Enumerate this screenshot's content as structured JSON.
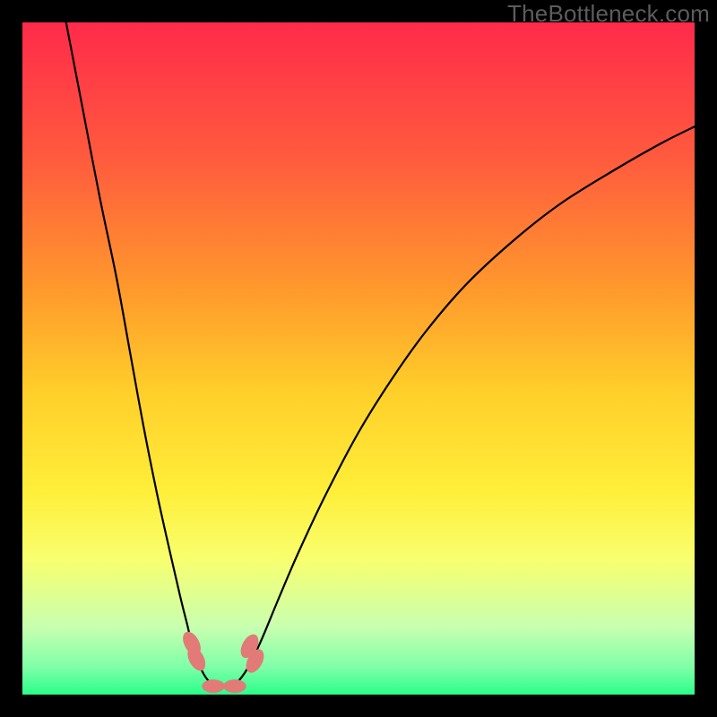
{
  "watermark_text": "TheBottleneck.com",
  "chart_data": {
    "type": "line",
    "title": "",
    "xlabel": "",
    "ylabel": "",
    "xlim": [
      0,
      100
    ],
    "ylim": [
      0,
      100
    ],
    "grid": false,
    "legend": false,
    "gradient_stops": [
      {
        "offset": 0.0,
        "color": "#ff2a4a"
      },
      {
        "offset": 0.2,
        "color": "#ff5a3e"
      },
      {
        "offset": 0.4,
        "color": "#ff9a2c"
      },
      {
        "offset": 0.55,
        "color": "#ffcf2a"
      },
      {
        "offset": 0.7,
        "color": "#ffef3a"
      },
      {
        "offset": 0.8,
        "color": "#f8ff70"
      },
      {
        "offset": 0.9,
        "color": "#c8ffb0"
      },
      {
        "offset": 0.96,
        "color": "#7effa8"
      },
      {
        "offset": 1.0,
        "color": "#2aff8a"
      }
    ],
    "series": [
      {
        "name": "left-branch",
        "stroke": "#000000",
        "stroke_width": 2.2,
        "points": [
          {
            "x": 6.5,
            "y": 100.0
          },
          {
            "x": 9.0,
            "y": 87.0
          },
          {
            "x": 11.5,
            "y": 74.0
          },
          {
            "x": 14.0,
            "y": 62.0
          },
          {
            "x": 16.0,
            "y": 51.0
          },
          {
            "x": 18.0,
            "y": 40.0
          },
          {
            "x": 20.0,
            "y": 30.0
          },
          {
            "x": 22.0,
            "y": 21.0
          },
          {
            "x": 23.5,
            "y": 14.5
          },
          {
            "x": 24.5,
            "y": 10.5
          },
          {
            "x": 25.5,
            "y": 6.5
          },
          {
            "x": 27.0,
            "y": 3.0
          },
          {
            "x": 28.5,
            "y": 1.4
          },
          {
            "x": 30.0,
            "y": 1.1
          }
        ]
      },
      {
        "name": "right-branch",
        "stroke": "#000000",
        "stroke_width": 2.2,
        "points": [
          {
            "x": 30.0,
            "y": 1.1
          },
          {
            "x": 31.5,
            "y": 1.4
          },
          {
            "x": 33.5,
            "y": 3.9
          },
          {
            "x": 35.5,
            "y": 8.0
          },
          {
            "x": 38.0,
            "y": 14.0
          },
          {
            "x": 41.0,
            "y": 21.0
          },
          {
            "x": 45.0,
            "y": 29.5
          },
          {
            "x": 50.0,
            "y": 39.0
          },
          {
            "x": 55.0,
            "y": 47.0
          },
          {
            "x": 60.0,
            "y": 54.0
          },
          {
            "x": 66.0,
            "y": 61.0
          },
          {
            "x": 73.0,
            "y": 67.5
          },
          {
            "x": 80.0,
            "y": 73.0
          },
          {
            "x": 88.0,
            "y": 78.0
          },
          {
            "x": 95.0,
            "y": 82.0
          },
          {
            "x": 100.0,
            "y": 84.5
          }
        ]
      }
    ],
    "markers": [
      {
        "x": 25.2,
        "y": 7.6,
        "rx": 1.1,
        "ry": 1.9,
        "angle": -28,
        "fill": "#e27a77"
      },
      {
        "x": 25.9,
        "y": 5.3,
        "rx": 1.1,
        "ry": 1.9,
        "angle": -28,
        "fill": "#e27a77"
      },
      {
        "x": 33.8,
        "y": 7.2,
        "rx": 1.1,
        "ry": 1.9,
        "angle": 28,
        "fill": "#e27a77"
      },
      {
        "x": 34.6,
        "y": 5.0,
        "rx": 1.1,
        "ry": 1.9,
        "angle": 28,
        "fill": "#e27a77"
      },
      {
        "x": 28.4,
        "y": 1.25,
        "rx": 1.0,
        "ry": 1.7,
        "angle": 90,
        "fill": "#e27a77"
      },
      {
        "x": 31.6,
        "y": 1.25,
        "rx": 1.0,
        "ry": 1.7,
        "angle": 90,
        "fill": "#e27a77"
      }
    ]
  }
}
